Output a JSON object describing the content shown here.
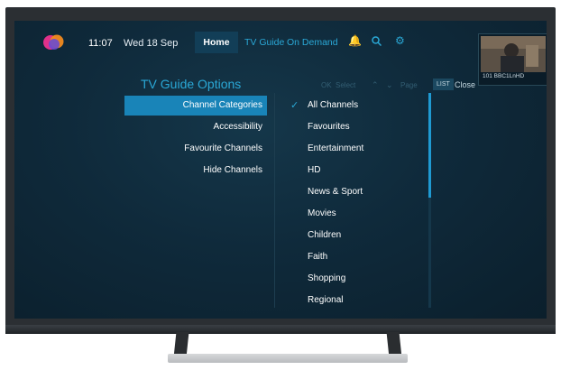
{
  "header": {
    "time": "11:07",
    "date": "Wed 18 Sep",
    "nav": {
      "home": "Home",
      "tv_guide": "TV Guide",
      "on_demand": "On Demand"
    },
    "icons": [
      "bell-icon",
      "search-icon",
      "gear-icon"
    ]
  },
  "preview": {
    "channel": "101 BBC1LnHD"
  },
  "options": {
    "title": "TV Guide Options",
    "hints": {
      "ok_key": "OK",
      "select": "Select",
      "page": "Page",
      "list_key": "LIST",
      "close": "Close"
    }
  },
  "left_menu": {
    "items": [
      {
        "label": "Channel Categories",
        "selected": true
      },
      {
        "label": "Accessibility"
      },
      {
        "label": "Favourite Channels"
      },
      {
        "label": "Hide Channels"
      }
    ]
  },
  "right_menu": {
    "items": [
      {
        "label": "All Channels",
        "checked": true
      },
      {
        "label": "Favourites"
      },
      {
        "label": "Entertainment"
      },
      {
        "label": "HD"
      },
      {
        "label": "News & Sport"
      },
      {
        "label": "Movies"
      },
      {
        "label": "Children"
      },
      {
        "label": "Faith"
      },
      {
        "label": "Shopping"
      },
      {
        "label": "Regional"
      }
    ]
  },
  "colors": {
    "accent": "#2aa8d6",
    "selected": "#1984b8",
    "background": "#0f2a3b"
  }
}
